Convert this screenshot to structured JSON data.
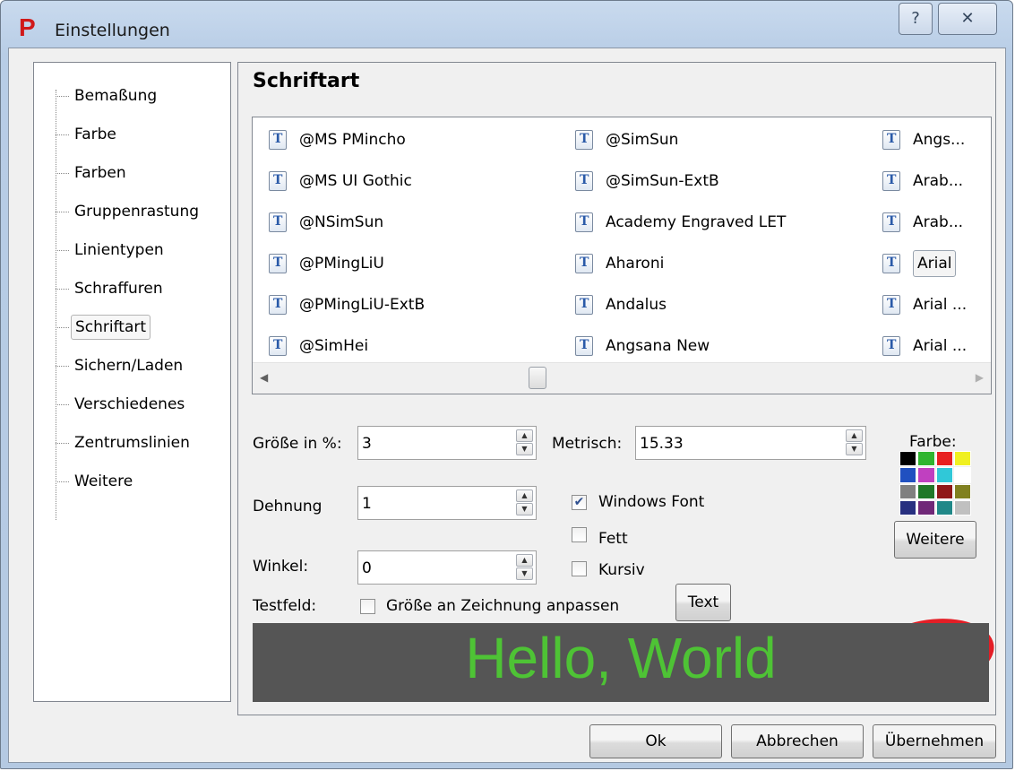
{
  "window": {
    "app_letter": "P",
    "title": "Einstellungen",
    "help_label": "?",
    "close_label": "✕"
  },
  "tree": {
    "items": [
      {
        "label": "Bemaßung"
      },
      {
        "label": "Farbe"
      },
      {
        "label": "Farben"
      },
      {
        "label": "Gruppenrastung"
      },
      {
        "label": "Linientypen"
      },
      {
        "label": "Schraffuren"
      },
      {
        "label": "Schriftart",
        "selected": true
      },
      {
        "label": "Sichern/Laden"
      },
      {
        "label": "Verschiedenes"
      },
      {
        "label": "Zentrumslinien"
      },
      {
        "label": "Weitere"
      }
    ]
  },
  "panel": {
    "heading": "Schriftart",
    "fonts": {
      "col1": [
        "@MS PMincho",
        "@MS UI Gothic",
        "@NSimSun",
        "@PMingLiU",
        "@PMingLiU-ExtB",
        "@SimHei"
      ],
      "col2": [
        "@SimSun",
        "@SimSun-ExtB",
        "Academy Engraved LET",
        "Aharoni",
        "Andalus",
        "Angsana New"
      ],
      "col3": [
        "Angs...",
        "Arab...",
        "Arab...",
        "Arial",
        "Arial ...",
        "Arial ..."
      ],
      "selected": "Arial",
      "icon": "truetype-font-icon"
    },
    "size_label": "Größe in %:",
    "size_value": "3",
    "metric_label": "Metrisch:",
    "metric_value": "15.33",
    "stretch_label": "Dehnung",
    "stretch_value": "1",
    "angle_label": "Winkel:",
    "angle_value": "0",
    "windows_font_label": "Windows Font",
    "windows_font_checked": true,
    "bold_label": "Fett",
    "bold_checked": false,
    "italic_label": "Kursiv",
    "italic_checked": false,
    "color_label": "Farbe:",
    "more_colors_label": "Weitere",
    "palette": [
      "#000000",
      "#2fb52f",
      "#e82020",
      "#f0f020",
      "#2050c0",
      "#c040c0",
      "#30c8d8",
      "#ffffff",
      "#808080",
      "#207828",
      "#901818",
      "#808020",
      "#283080",
      "#702878",
      "#208888",
      "#c0c0c0"
    ],
    "test_label": "Testfeld:",
    "fit_label": "Größe an Zeichnung anpassen",
    "fit_checked": false,
    "text_button": "Text",
    "preview_text": "Hello, World",
    "preview_bg": "#555555",
    "preview_color": "#4ec335"
  },
  "footer": {
    "ok": "Ok",
    "cancel": "Abbrechen",
    "apply": "Übernehmen"
  }
}
